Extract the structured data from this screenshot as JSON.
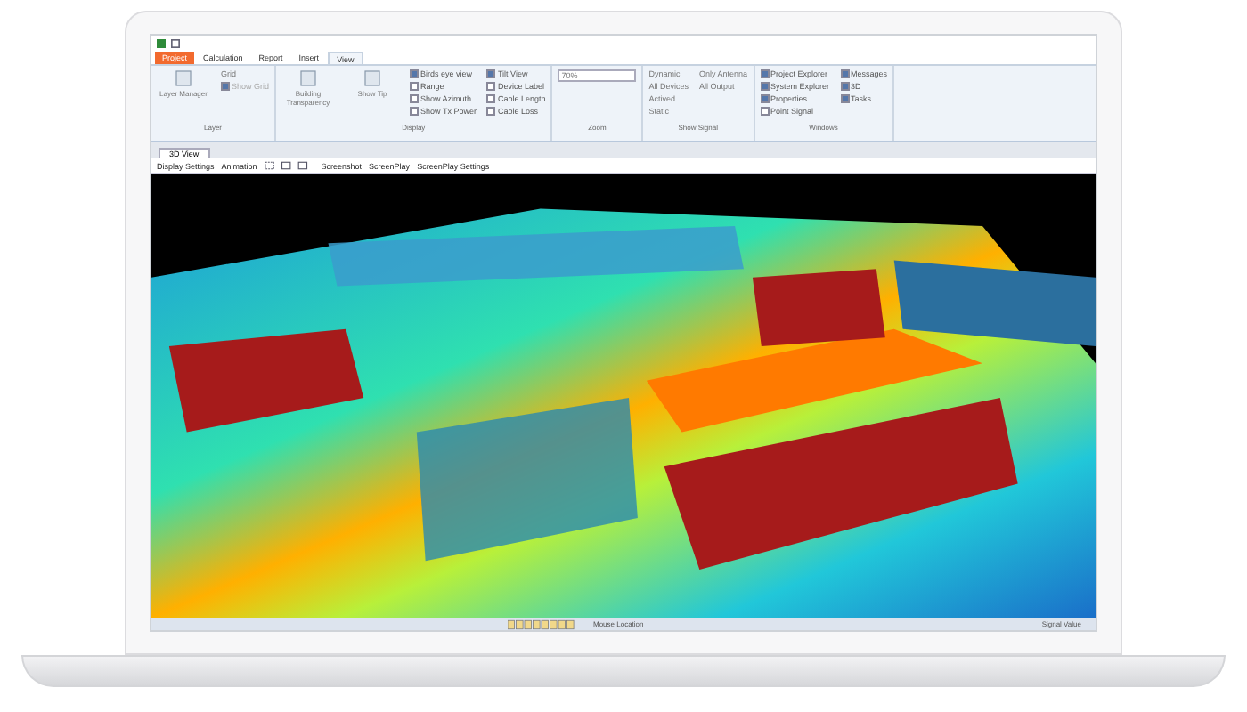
{
  "ribbon": {
    "tabs": [
      {
        "label": "Project",
        "kind": "app-menu",
        "selected": false
      },
      {
        "label": "Calculation",
        "kind": "tab",
        "selected": false
      },
      {
        "label": "Report",
        "kind": "tab",
        "selected": false
      },
      {
        "label": "Insert",
        "kind": "tab",
        "selected": false
      },
      {
        "label": "View",
        "kind": "tab",
        "selected": true
      }
    ],
    "groups": [
      {
        "title": "Layer",
        "items": [
          {
            "kind": "big",
            "label": "Layer Manager"
          },
          {
            "kind": "text",
            "label": "Grid"
          },
          {
            "kind": "check",
            "label": "Show Grid",
            "checked": true,
            "disabled": true
          }
        ]
      },
      {
        "title": "Display",
        "items": [
          {
            "kind": "big",
            "label": "Building Transparency"
          },
          {
            "kind": "big",
            "label": "Show Tip"
          },
          {
            "kind": "check",
            "label": "Birds eye view",
            "checked": true,
            "disabled": false
          },
          {
            "kind": "check",
            "label": "Range",
            "checked": false,
            "disabled": false
          },
          {
            "kind": "check",
            "label": "Show Azimuth",
            "checked": false,
            "disabled": false
          },
          {
            "kind": "check",
            "label": "Show Tx Power",
            "checked": false,
            "disabled": false
          },
          {
            "kind": "check",
            "label": "Tilt View",
            "checked": true,
            "disabled": false
          },
          {
            "kind": "check",
            "label": "Device Label",
            "checked": false,
            "disabled": false
          },
          {
            "kind": "check",
            "label": "Cable Length",
            "checked": false,
            "disabled": false
          },
          {
            "kind": "check",
            "label": "Cable Loss",
            "checked": false,
            "disabled": false
          }
        ]
      },
      {
        "title": "Zoom",
        "items": [
          {
            "kind": "select",
            "label": "70%"
          }
        ]
      },
      {
        "title": "Show Signal",
        "items": [
          {
            "kind": "text",
            "label": "Dynamic"
          },
          {
            "kind": "text",
            "label": "All Devices"
          },
          {
            "kind": "text",
            "label": "Actived"
          },
          {
            "kind": "text",
            "label": "Static"
          },
          {
            "kind": "text",
            "label": "Only Antenna"
          },
          {
            "kind": "text",
            "label": "All Output"
          }
        ]
      },
      {
        "title": "Windows",
        "items": [
          {
            "kind": "check",
            "label": "Project Explorer",
            "checked": true,
            "disabled": false
          },
          {
            "kind": "check",
            "label": "System Explorer",
            "checked": true,
            "disabled": false
          },
          {
            "kind": "check",
            "label": "Properties",
            "checked": true,
            "disabled": false
          },
          {
            "kind": "check",
            "label": "Point Signal",
            "checked": false,
            "disabled": false
          },
          {
            "kind": "check",
            "label": "Messages",
            "checked": true,
            "disabled": false
          },
          {
            "kind": "check",
            "label": "3D",
            "checked": true,
            "disabled": false
          },
          {
            "kind": "check",
            "label": "Tasks",
            "checked": true,
            "disabled": false
          }
        ]
      }
    ]
  },
  "document_tab": {
    "label": "3D View"
  },
  "toolbar": {
    "items": [
      {
        "kind": "text",
        "label": "Display Settings"
      },
      {
        "kind": "text",
        "label": "Animation"
      },
      {
        "kind": "icon"
      },
      {
        "kind": "text",
        "label": "Screenshot"
      },
      {
        "kind": "text",
        "label": "ScreenPlay"
      },
      {
        "kind": "text",
        "label": "ScreenPlay Settings"
      }
    ]
  },
  "status_bar": {
    "left": "Mouse Location",
    "right": "Signal Value"
  }
}
